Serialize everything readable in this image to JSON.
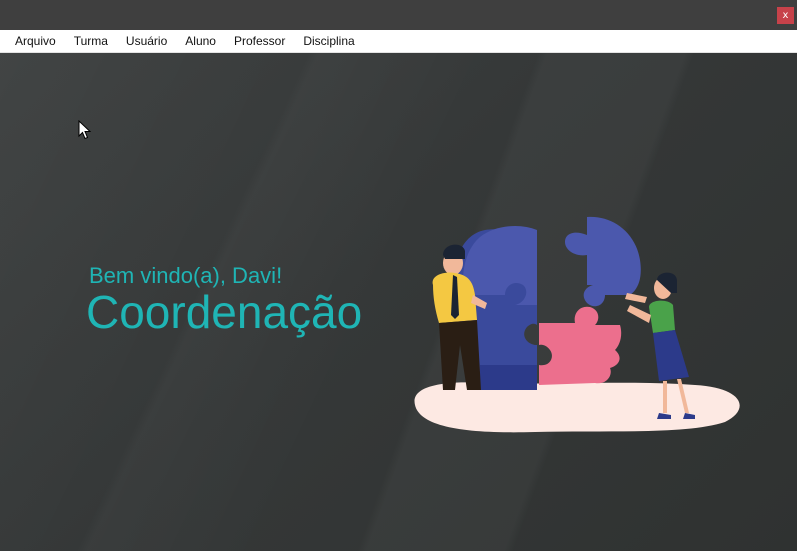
{
  "window": {
    "close_label": "x"
  },
  "menu": {
    "items": [
      {
        "label": "Arquivo"
      },
      {
        "label": "Turma"
      },
      {
        "label": "Usuário"
      },
      {
        "label": "Aluno"
      },
      {
        "label": "Professor"
      },
      {
        "label": "Disciplina"
      }
    ]
  },
  "main": {
    "welcome": "Bem vindo(a), Davi!",
    "title": "Coordenação"
  },
  "colors": {
    "accent": "#1fb5b5",
    "close": "#c7424a",
    "background": "#3a3c3c"
  },
  "icons": [
    "close-icon",
    "mouse-cursor-icon",
    "puzzle-head-illustration"
  ]
}
